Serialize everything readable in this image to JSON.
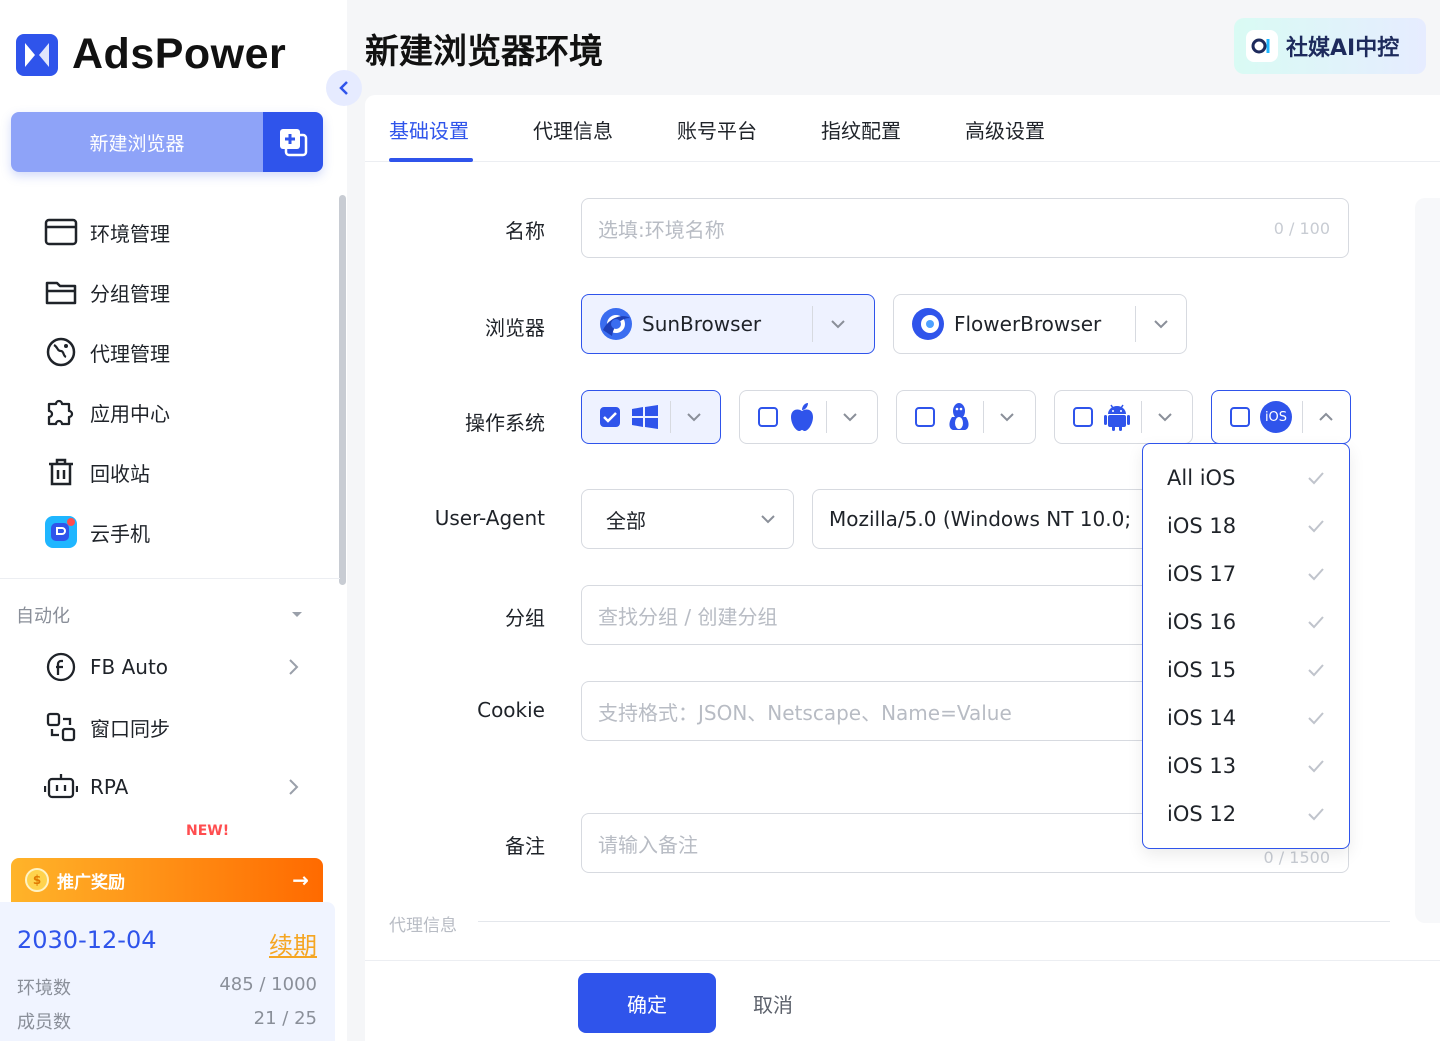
{
  "brand": {
    "name": "AdsPower"
  },
  "sidebar": {
    "new_browser_label": "新建浏览器",
    "items": [
      {
        "label": "环境管理",
        "icon": "window-icon"
      },
      {
        "label": "分组管理",
        "icon": "folder-icon"
      },
      {
        "label": "代理管理",
        "icon": "globe-icon"
      },
      {
        "label": "应用中心",
        "icon": "puzzle-icon"
      },
      {
        "label": "回收站",
        "icon": "trash-icon"
      },
      {
        "label": "云手机",
        "icon": "cloud-phone-icon"
      }
    ],
    "automation": {
      "title": "自动化",
      "items": [
        {
          "label": "FB Auto",
          "icon": "facebook-icon"
        },
        {
          "label": "窗口同步",
          "icon": "sync-icon"
        },
        {
          "label": "RPA",
          "icon": "robot-icon"
        }
      ],
      "new_tag": "NEW!"
    },
    "promo": {
      "label": "推广奖励",
      "arrow": "→"
    },
    "account": {
      "expire_date": "2030-12-04",
      "renew_label": "续期",
      "env_label": "环境数",
      "env_value": "485 / 1000",
      "member_label": "成员数",
      "member_value": "21 / 25"
    }
  },
  "header": {
    "title": "新建浏览器环境",
    "ai_badge": "社媒AI中控"
  },
  "tabs": [
    "基础设置",
    "代理信息",
    "账号平台",
    "指纹配置",
    "高级设置"
  ],
  "form": {
    "name": {
      "label": "名称",
      "placeholder": "选填:环境名称",
      "count": "0 / 100"
    },
    "browser": {
      "label": "浏览器",
      "options": [
        "SunBrowser",
        "FlowerBrowser"
      ]
    },
    "os": {
      "label": "操作系统",
      "ios_label": "iOS"
    },
    "user_agent": {
      "label": "User-Agent",
      "mode": "全部",
      "value": "Mozilla/5.0 (Windows NT 10.0;"
    },
    "group": {
      "label": "分组",
      "placeholder": "查找分组 / 创建分组"
    },
    "cookie": {
      "label": "Cookie",
      "placeholder": "支持格式：JSON、Netscape、Name=Value"
    },
    "remark": {
      "label": "备注",
      "placeholder": "请输入备注",
      "count": "0 / 1500"
    }
  },
  "ios_dropdown": [
    "All iOS",
    "iOS 18",
    "iOS 17",
    "iOS 16",
    "iOS 15",
    "iOS 14",
    "iOS 13",
    "iOS 12"
  ],
  "proxy_section_label": "代理信息",
  "footer": {
    "ok_label": "确定",
    "cancel_label": "取消"
  },
  "colors": {
    "primary": "#2f54eb",
    "accent_orange": "#ff6a00",
    "renew": "#f5a623"
  }
}
